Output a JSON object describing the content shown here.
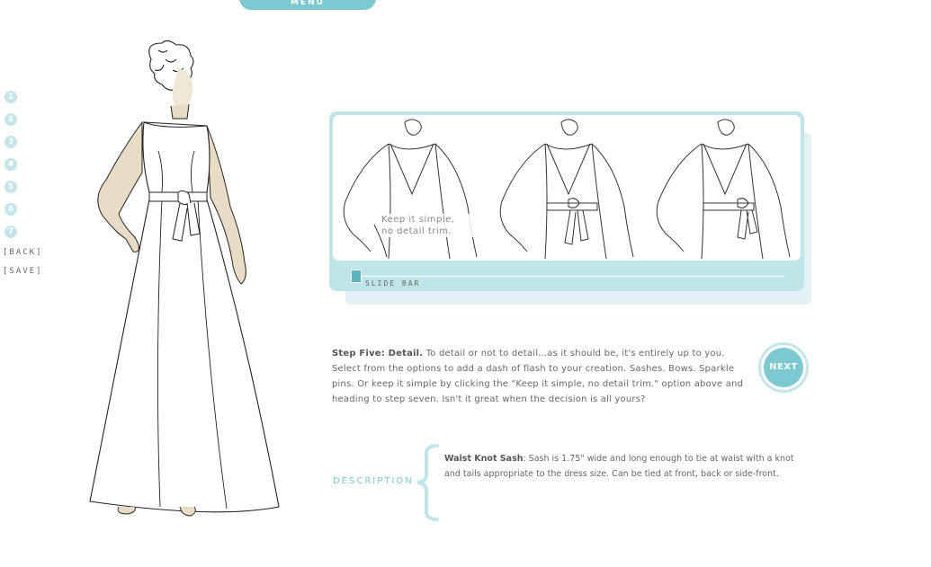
{
  "menu": {
    "label": "MENU"
  },
  "step_nav": {
    "steps": [
      "1",
      "2",
      "3",
      "4",
      "5",
      "6",
      "7"
    ],
    "back_label": "[BACK]",
    "save_label": "[SAVE]"
  },
  "options_panel": {
    "options": [
      {
        "caption_line1": "Keep it simple,",
        "caption_line2": "no detail trim."
      },
      {
        "caption_line1": "",
        "caption_line2": ""
      },
      {
        "caption_line1": "",
        "caption_line2": ""
      }
    ],
    "slide_bar_label": "SLIDE BAR"
  },
  "step": {
    "title": "Step Five: Detail.",
    "body": " To detail or not to detail...as it should be, it's entirely up to you. Select from the options to add a dash of flash to your creation. Sashes. Bows. Sparkle pins. Or keep it simple by clicking the \"Keep it simple, no detail trim.\" option above and heading to step seven. Isn't it great when the decision is all yours?"
  },
  "next_button": {
    "label": "NEXT"
  },
  "description": {
    "label": "DESCRIPTION",
    "item_name": "Waist Knot Sash",
    "item_text": ": Sash is 1.75\" wide and long enough to tie at waist with a knot and tails appropriate to the dress size. Can be tied at front, back or side-front."
  },
  "colors": {
    "accent": "#7cc9d1",
    "light_accent": "#bfe5e9",
    "skin": "#e8dcc4"
  }
}
